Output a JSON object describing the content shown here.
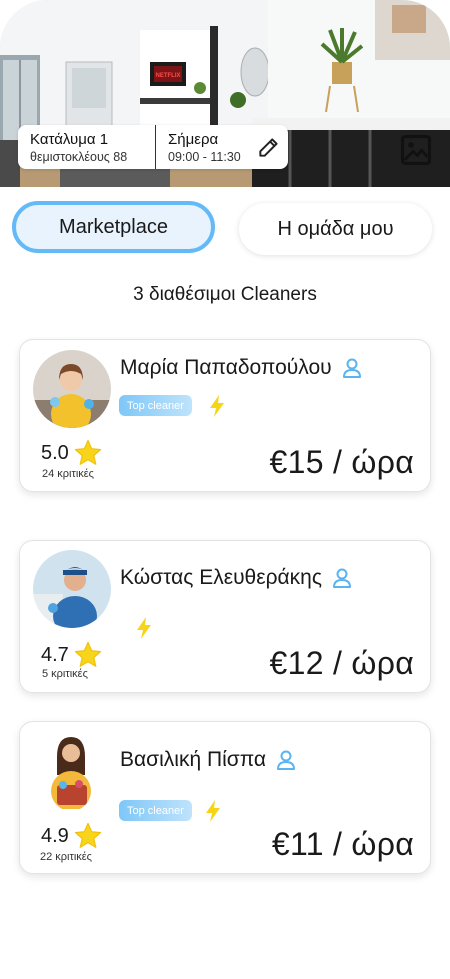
{
  "hero": {
    "property_name": "Κατάλυμα  1",
    "property_address": "θεμιστοκλέους 88",
    "day_label": "Σήμερα",
    "time_range": "09:00 - 11:30",
    "tv_brand": "NETFLIX"
  },
  "tabs": {
    "marketplace": "Marketplace",
    "my_team": "Η ομάδα μου"
  },
  "available_count": "3 διαθέσιμοι Cleaners",
  "cleaners": [
    {
      "name": "Μαρία Παπαδοπούλου",
      "badge": "Top cleaner",
      "rating": "5.0",
      "reviews": "24 κριτικές",
      "price": "€15 / ώρα"
    },
    {
      "name": "Κώστας Ελευθεράκης",
      "badge": "",
      "rating": "4.7",
      "reviews": "5 κριτικές",
      "price": "€12 / ώρα"
    },
    {
      "name": "Βασιλική Πίσπα",
      "badge": "Top cleaner",
      "rating": "4.9",
      "reviews": "22 κριτικές",
      "price": "€11 / ώρα"
    }
  ],
  "colors": {
    "accent": "#64b9f7",
    "tab_bg": "#e8f3fd",
    "star": "#f8d41a",
    "bolt": "#f5d515",
    "person_icon": "#5ab4f2"
  },
  "icons": {
    "edit": "pencil-icon",
    "photo": "image-icon",
    "person": "person-icon",
    "bolt": "lightning-icon",
    "star": "star-icon"
  }
}
